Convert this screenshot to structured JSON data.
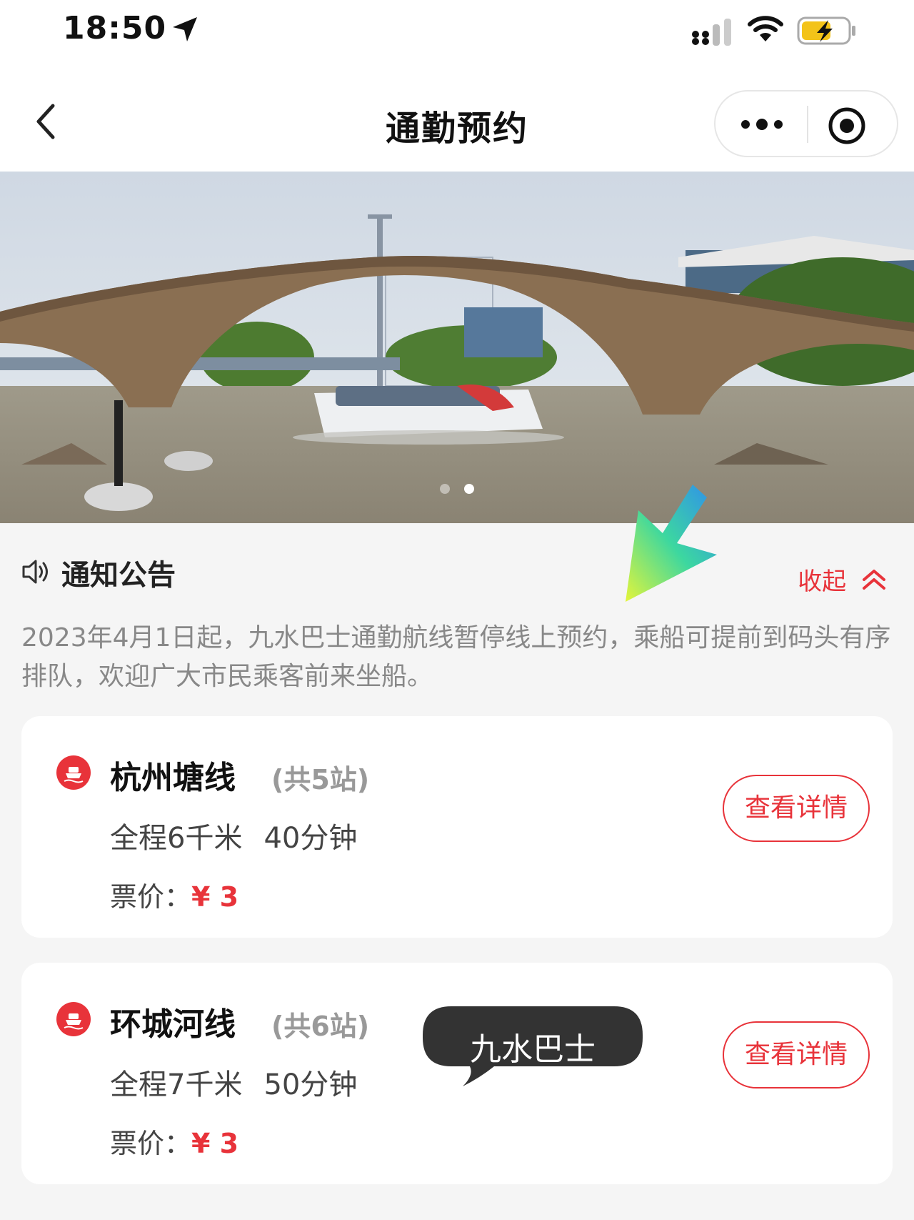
{
  "status_bar": {
    "time": "18:50"
  },
  "nav": {
    "title": "通勤预约"
  },
  "banner": {
    "slide_count": 2,
    "active_index": 1
  },
  "notice": {
    "title": "通知公告",
    "collapse_label": "收起",
    "text": "2023年4月1日起，九水巴士通勤航线暂停线上预约，乘船可提前到码头有序排队，欢迎广大市民乘客前来坐船。"
  },
  "routes": [
    {
      "name": "杭州塘线",
      "stations": "(共5站)",
      "distance": "全程6千米",
      "duration": "40分钟",
      "price_label": "票价：",
      "price_value": "¥ 3",
      "detail_label": "查看详情"
    },
    {
      "name": "环城河线",
      "stations": "(共6站)",
      "distance": "全程7千米",
      "duration": "50分钟",
      "price_label": "票价：",
      "price_value": "¥ 3",
      "detail_label": "查看详情"
    }
  ],
  "bubble": {
    "text": "九水巴士"
  },
  "colors": {
    "accent": "#e8333a",
    "page_bg": "#f5f5f5",
    "card_bg": "#ffffff",
    "muted_text": "#888888"
  }
}
